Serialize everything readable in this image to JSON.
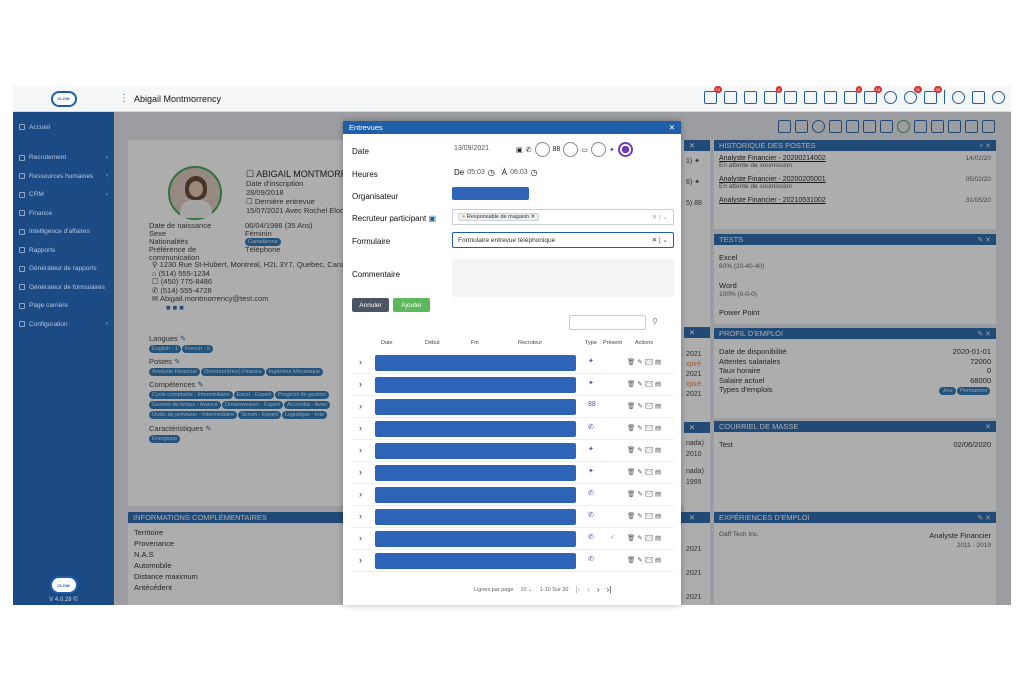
{
  "topbar": {
    "user_name": "Abigail Montmorrency",
    "logo_text": "CLOW",
    "badges": [
      "74",
      "4",
      "2",
      "15",
      "11",
      "29"
    ]
  },
  "sidebar": {
    "items": [
      {
        "label": "Accueil",
        "chevron": false
      },
      {
        "label": "Recrutement",
        "chevron": true
      },
      {
        "label": "Ressources humaines",
        "chevron": true
      },
      {
        "label": "CRM",
        "chevron": true
      },
      {
        "label": "Finance",
        "chevron": false
      },
      {
        "label": "Intelligence d'affaires",
        "chevron": false
      },
      {
        "label": "Rapports",
        "chevron": false
      },
      {
        "label": "Générateur de rapports",
        "chevron": false
      },
      {
        "label": "Générateur de formulaires",
        "chevron": false
      },
      {
        "label": "Page carrière",
        "chevron": false
      },
      {
        "label": "Configuration",
        "chevron": true
      }
    ],
    "version": "V 4.0.28 ©"
  },
  "profile": {
    "name": "ABIGAIL MONTMORRENC",
    "inscription_label": "Date d'inscription",
    "inscription_date": "28/09/2018",
    "last_interview_label": "Dernière entrevue",
    "last_interview_value": "15/07/2021 Avec Rochel Elodie",
    "birth_label": "Date de naissance",
    "birth_value": "06/04/1986 (35 Ans)",
    "sex_label": "Sexe",
    "sex_value": "Féminin",
    "nationality_label": "Nationalités",
    "nationality_value": "Canadienne",
    "pref_label": "Préférence de communication",
    "pref_value": "Téléphone",
    "address": "1230 Rue St-Hubert, Montreal, H2L 3Y7, Quebec, Canad",
    "phone1": "(514) 555-1234",
    "phone2": "(450) 775-8486",
    "phone3": "(514) 555-4728",
    "email": "Abigail.montmorrency@test.com",
    "langues_label": "Langues",
    "langues": [
      "English - 1",
      "French - 5"
    ],
    "postes_label": "Postes",
    "postes": [
      "Analyste Financier",
      "Directeur(trice) Finance",
      "Ingénieur Mécanique"
    ],
    "competences_label": "Compétences",
    "competences": [
      "Cycle comptable - Intermédiaire",
      "Excel - Expert",
      "Progiciel de gestion",
      "Gestion du temps - Avancé",
      "Dreamweaver - Expert",
      "Accomba - Avan",
      "Outils de prévision - Intermédiaire",
      "Scrum - Expert",
      "Logistique - Inte"
    ],
    "caracteristiques_label": "Caractéristiques",
    "caracteristiques": [
      "Énergique"
    ]
  },
  "info_comp": {
    "title": "INFORMATIONS COMPLÉMENTAIRES",
    "fields": [
      "Territoire",
      "Provenance",
      "N.A.S",
      "Automobile",
      "Distance maximum",
      "Antécédent"
    ]
  },
  "mid_strip": [
    "1) ✦",
    "6) ✦",
    "5) 88",
    "2021",
    "xpiré",
    "2021",
    "xpiré",
    "2021",
    "nada)",
    "2010",
    "nada)",
    "1995",
    "2021",
    "2021",
    "2021"
  ],
  "historique": {
    "title": "HISTORIQUE DES POSTES",
    "rows": [
      {
        "title": "Analyste Financier - 20200214002",
        "status": "En attente de soumission",
        "date": "14/02/20"
      },
      {
        "title": "Analyste Financier - 20200205001",
        "status": "En attente de soumission",
        "date": "05/02/20"
      },
      {
        "title": "Analyste Financier - 20210531002",
        "status": "",
        "date": "31/05/20"
      }
    ]
  },
  "tests": {
    "title": "TESTS",
    "rows": [
      {
        "name": "Excel",
        "score": "60% (20-40-40)"
      },
      {
        "name": "Word",
        "score": "100% (0-0-0)"
      },
      {
        "name": "Power Point",
        "score": ""
      }
    ]
  },
  "profil_emploi": {
    "title": "PROFIL D'EMPLOI",
    "rows": [
      {
        "label": "Date de disponibilité",
        "value": "2020-01-01"
      },
      {
        "label": "Attentes salariales",
        "value": "72000"
      },
      {
        "label": "Taux horaire",
        "value": "0"
      },
      {
        "label": "Salaire actuel",
        "value": "68000"
      },
      {
        "label": "Types d'emplois",
        "value": ""
      }
    ],
    "types": [
      "Jour",
      "Permanent"
    ]
  },
  "courriel": {
    "title": "COURRIEL DE MASSE",
    "label": "Test",
    "date": "02/06/2020"
  },
  "experiences": {
    "title": "EXPÉRIENCES D'EMPLOI",
    "company": "Gaff Tech Inc.",
    "role": "Analyste Financier",
    "years": "2011 - 2019"
  },
  "modal": {
    "title": "Entrevues",
    "date_label": "Date",
    "date_value": "13/09/2021",
    "heures_label": "Heures",
    "de_label": "De",
    "de_value": "05:03",
    "a_label": "À",
    "a_value": "06:03",
    "organisateur_label": "Organisateur",
    "recruteur_label": "Recruteur participant",
    "recruteur_tag": "Responsable de magasin",
    "formulaire_label": "Formulaire",
    "formulaire_value": "Formulaire entrevue téléphonique",
    "commentaire_label": "Commentaire",
    "annuler": "Annuler",
    "ajouter": "Ajouter",
    "columns": [
      "Date",
      "Début",
      "Fin",
      "Recruteur",
      "Type",
      "Présent",
      "Actions"
    ],
    "rows": [
      {
        "type": "✦",
        "present": ""
      },
      {
        "type": "✦",
        "present": ""
      },
      {
        "type": "88",
        "present": ""
      },
      {
        "type": "✆",
        "present": ""
      },
      {
        "type": "✦",
        "present": ""
      },
      {
        "type": "✦",
        "present": ""
      },
      {
        "type": "✆",
        "present": ""
      },
      {
        "type": "✆",
        "present": ""
      },
      {
        "type": "✆",
        "present": "✓"
      },
      {
        "type": "✆",
        "present": ""
      }
    ],
    "footer_rows_label": "Lignes par page",
    "footer_rows_value": "10",
    "footer_range": "1-10 Sur 30"
  },
  "colors": {
    "primary": "#1f5fa9",
    "sidebar": "#1c4a85",
    "green_button": "#5cb85c",
    "dark_button": "#4a5563"
  }
}
